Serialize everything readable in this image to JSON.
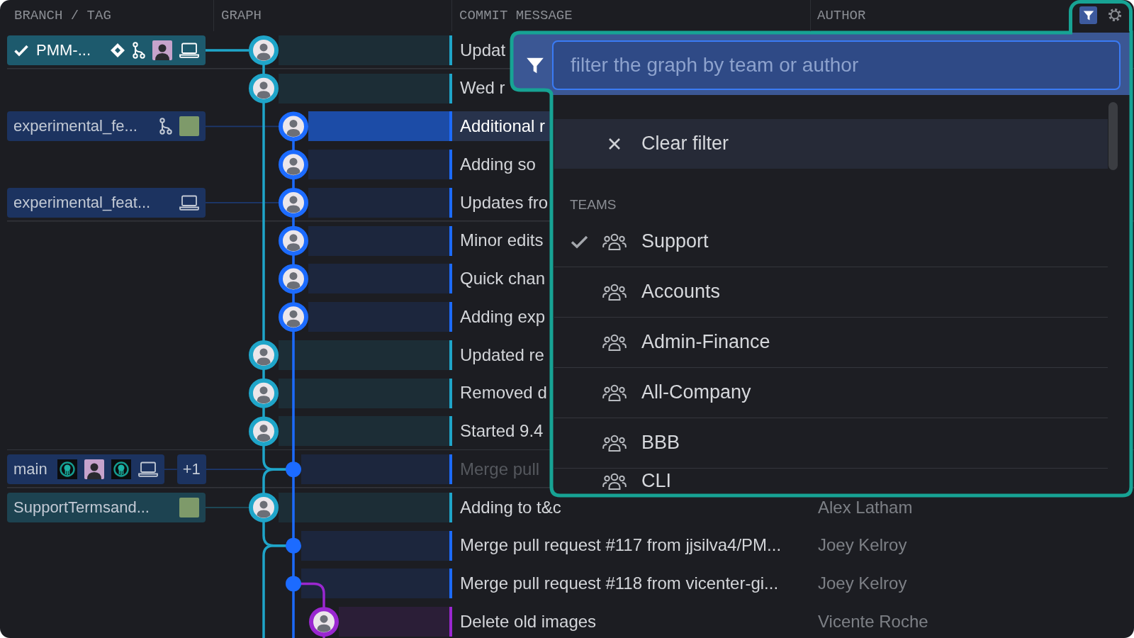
{
  "header": {
    "columns": [
      "BRANCH / TAG",
      "GRAPH",
      "COMMIT MESSAGE",
      "AUTHOR"
    ],
    "filter_button": {
      "active": true
    }
  },
  "row_groups": [
    {
      "rows": [
        {
          "branch": {
            "label": "PMM-...",
            "current": true,
            "icons": [
              {
                "kind": "issue"
              },
              {
                "kind": "pullrequest"
              },
              {
                "kind": "avatar"
              },
              {
                "kind": "local"
              }
            ]
          },
          "commit": {
            "kind": "avatar",
            "color": "#1fa5c9"
          },
          "message": "Updat",
          "selected": false,
          "dimmed": false
        }
      ]
    },
    {
      "rows": [
        {
          "commit": {
            "kind": "avatar",
            "color": "#1fa5c9"
          },
          "message": "Wed r",
          "selected": false,
          "dimmed": false
        },
        {
          "branch": {
            "label": "experimental_fe...",
            "current": false,
            "icons": [
              {
                "kind": "pullrequest"
              },
              {
                "kind": "picture"
              }
            ]
          },
          "commit": {
            "kind": "avatar",
            "color": "#1c6bff"
          },
          "message": "Additional r",
          "selected": true,
          "dimmed": false
        },
        {
          "commit": {
            "kind": "avatar",
            "color": "#1c6bff"
          },
          "message": "Adding so",
          "selected": false,
          "dimmed": false
        },
        {
          "branch": {
            "label": "experimental_feat...",
            "current": false,
            "icons": [
              {
                "kind": "local"
              }
            ]
          },
          "commit": {
            "kind": "avatar",
            "color": "#1c6bff"
          },
          "message": "Updates fro",
          "selected": false,
          "dimmed": false
        }
      ]
    },
    {
      "rows": [
        {
          "commit": {
            "kind": "avatar",
            "color": "#1c6bff"
          },
          "message": "Minor edits",
          "selected": false,
          "dimmed": false
        },
        {
          "commit": {
            "kind": "avatar",
            "color": "#1c6bff"
          },
          "message": "Quick chan",
          "selected": false,
          "dimmed": false
        },
        {
          "commit": {
            "kind": "avatar",
            "color": "#1c6bff"
          },
          "message": "Adding exp",
          "selected": false,
          "dimmed": false
        },
        {
          "commit": {
            "kind": "avatar",
            "color": "#1fa5c9"
          },
          "message": "Updated re",
          "selected": false,
          "dimmed": false
        },
        {
          "commit": {
            "kind": "avatar",
            "color": "#1fa5c9"
          },
          "message": "Removed d",
          "selected": false,
          "dimmed": false
        },
        {
          "commit": {
            "kind": "avatar",
            "color": "#1fa5c9"
          },
          "message": "Started 9.4",
          "selected": false,
          "dimmed": false
        }
      ]
    },
    {
      "rows": [
        {
          "branch": {
            "label": "main",
            "current": false,
            "icons": [
              {
                "kind": "logo"
              },
              {
                "kind": "avatar"
              },
              {
                "kind": "logo"
              },
              {
                "kind": "local"
              }
            ],
            "more": "+1"
          },
          "commit": {
            "kind": "merge",
            "color": "#1c6bff"
          },
          "message": "Merge pull",
          "selected": false,
          "dimmed": true
        }
      ]
    },
    {
      "rows": [
        {
          "branch": {
            "label": "SupportTermsand...",
            "current": false,
            "icons": [
              {
                "kind": "picture"
              }
            ]
          },
          "commit": {
            "kind": "avatar",
            "color": "#1fa5c9"
          },
          "message": "Adding to t&c",
          "author": "Alex Latham",
          "selected": false,
          "dimmed": false
        },
        {
          "commit": {
            "kind": "merge",
            "color": "#1c6bff"
          },
          "message": "Merge pull request #117 from jjsilva4/PM...",
          "author": "Joey Kelroy",
          "selected": false,
          "dimmed": false
        },
        {
          "commit": {
            "kind": "merge",
            "color": "#1c6bff"
          },
          "message": "Merge pull request #118 from vicenter-gi...",
          "author": "Joey Kelroy",
          "selected": false,
          "dimmed": false
        },
        {
          "commit": {
            "kind": "avatar",
            "color": "#9a27d0"
          },
          "message": "Delete old images",
          "author": "Vicente Roche",
          "selected": false,
          "dimmed": false
        }
      ]
    }
  ],
  "filter": {
    "placeholder": "filter the graph by team or author",
    "clear_label": "Clear filter",
    "section_label": "TEAMS",
    "teams": [
      {
        "name": "Support",
        "selected": true
      },
      {
        "name": "Accounts",
        "selected": false
      },
      {
        "name": "Admin-Finance",
        "selected": false
      },
      {
        "name": "All-Company",
        "selected": false
      },
      {
        "name": "BBB",
        "selected": false
      },
      {
        "name": "CLI",
        "selected": false
      }
    ]
  }
}
